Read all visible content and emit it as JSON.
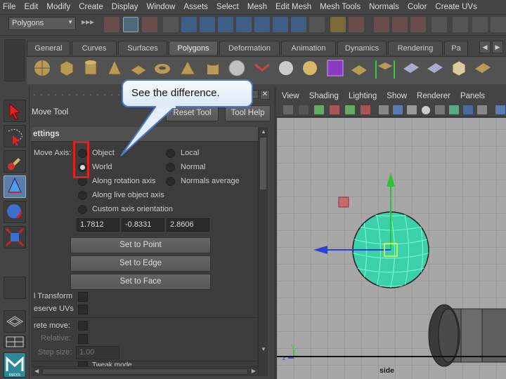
{
  "menubar": [
    "File",
    "Edit",
    "Modify",
    "Create",
    "Display",
    "Window",
    "Assets",
    "Select",
    "Mesh",
    "Edit Mesh",
    "Mesh Tools",
    "Normals",
    "Color",
    "Create UVs"
  ],
  "statusline": {
    "mode": "Polygons"
  },
  "shelf": {
    "tabs": [
      "General",
      "Curves",
      "Surfaces",
      "Polygons",
      "Deformation",
      "Animation",
      "Dynamics",
      "Rendering",
      "Pa"
    ],
    "active_tab": "Polygons"
  },
  "tool_settings": {
    "title": "Move Tool",
    "reset_label": "Reset Tool",
    "help_label": "Tool Help",
    "section": "ettings",
    "move_axis_label": "Move Axis:",
    "radios": [
      "Object",
      "Local",
      "World",
      "Normal",
      "Along rotation axis",
      "Normals average",
      "Along live object axis",
      "Custom axis orientation"
    ],
    "selected_radio": "World",
    "coords": [
      "1.7812",
      "-0.8331",
      "2.8606"
    ],
    "set_to_point": "Set to Point",
    "set_to_edge": "Set to Edge",
    "set_to_face": "Set to Face",
    "transform_label": "l Transform",
    "preserve_uvs_label": "eserve UVs",
    "discrete_move_label": "rete move:",
    "relative_label": "Relative:",
    "step_size_label": "Step size:",
    "step_size_value": "1.00",
    "tweak_mode_label": "Tweak mode"
  },
  "viewport": {
    "menu": [
      "View",
      "Shading",
      "Lighting",
      "Show",
      "Renderer",
      "Panels"
    ],
    "camera_label": "side"
  },
  "callout": {
    "text": "See the difference."
  },
  "colors": {
    "highlight": "#e0201e",
    "callout_border": "#4b7ac0",
    "sphere": "#3bd0a8"
  }
}
